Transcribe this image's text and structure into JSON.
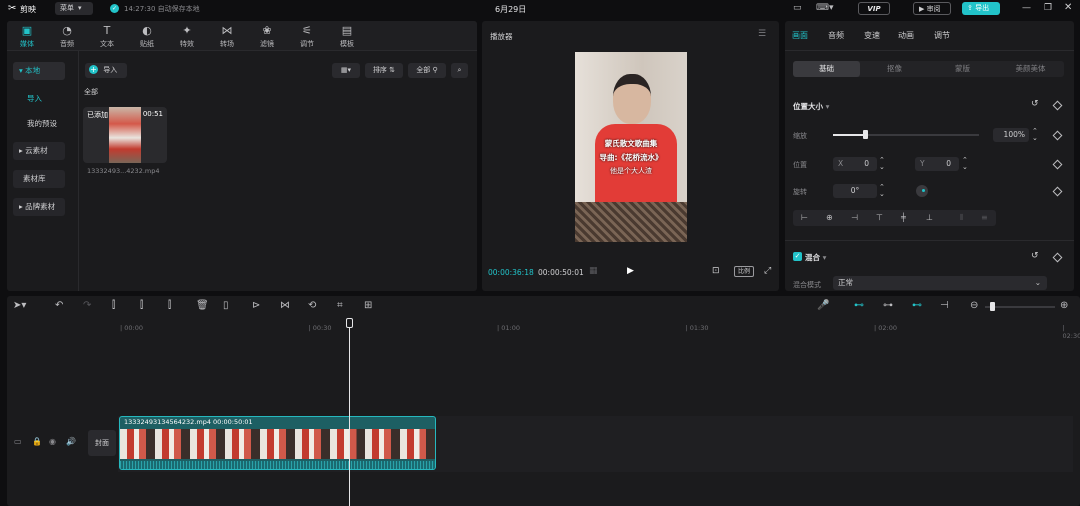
{
  "app": {
    "name": "剪映",
    "menu_label": "菜单",
    "autosave": "14:27:30 自动保存本地",
    "project_title": "6月29日",
    "vip": "VIP",
    "review_label": "审阅",
    "export_label": "导出"
  },
  "media_tabs": [
    {
      "label": "媒体",
      "icon": "media-icon"
    },
    {
      "label": "音频",
      "icon": "audio-icon"
    },
    {
      "label": "文本",
      "icon": "text-icon"
    },
    {
      "label": "贴纸",
      "icon": "sticker-icon"
    },
    {
      "label": "特效",
      "icon": "effects-icon"
    },
    {
      "label": "转场",
      "icon": "transition-icon"
    },
    {
      "label": "滤镜",
      "icon": "filter-icon"
    },
    {
      "label": "调节",
      "icon": "adjust-icon"
    },
    {
      "label": "模板",
      "icon": "template-icon"
    }
  ],
  "sidebar": {
    "local": "本地",
    "import": "导入",
    "presets": "我的预设",
    "cloud": "云素材",
    "library": "素材库",
    "brand": "品牌素材"
  },
  "media": {
    "import_button": "导入",
    "sort": "排序",
    "all_filter": "全部",
    "section": "全部",
    "item": {
      "badge": "已添加",
      "duration": "00:51",
      "filename": "13332493...4232.mp4"
    }
  },
  "player": {
    "title": "播放器",
    "caption_line1": "蒙氏散文歌曲集",
    "caption_line2": "导曲:《花桥流水》",
    "caption_line3": "他是个大人渣",
    "current_time": "00:00:36:18",
    "total_time": "00:00:50:01",
    "ratio": "比例"
  },
  "inspector": {
    "tabs": [
      "画面",
      "音频",
      "变速",
      "动画",
      "调节"
    ],
    "subtabs": [
      "基础",
      "抠像",
      "蒙版",
      "美颜美体"
    ],
    "position_size": "位置大小",
    "scale_label": "缩放",
    "scale_value": "100%",
    "scale_fraction": 0.22,
    "position_label": "位置",
    "x_label": "X",
    "x_value": "0",
    "y_label": "Y",
    "y_value": "0",
    "rotate_label": "旋转",
    "rotate_value": "0°",
    "blend": "混合",
    "blend_mode_label": "混合模式",
    "blend_mode_value": "正常"
  },
  "timeline": {
    "ticks": [
      "00:00",
      "00:30",
      "01:00",
      "01:30",
      "02:00",
      "02:30"
    ],
    "cover_label": "封面",
    "clip_label": "13332493134564232.mp4  00:00:50:01",
    "colors": {
      "accent": "#22c3c9",
      "clip_border": "#26b8be",
      "wave": "#1d7f86"
    }
  }
}
